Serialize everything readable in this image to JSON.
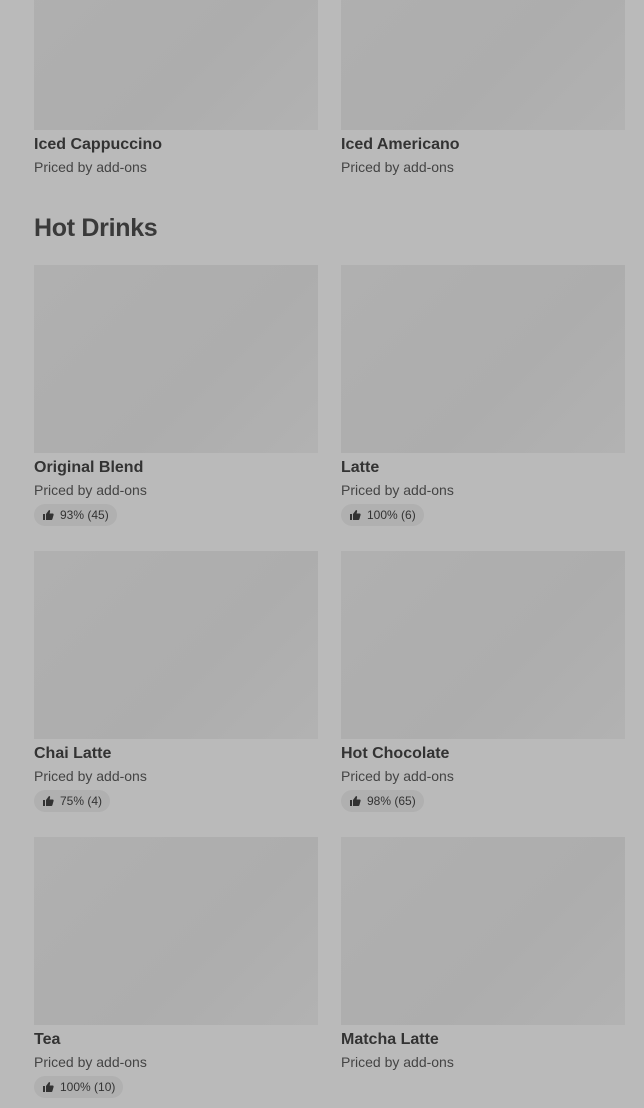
{
  "section": {
    "title": "Hot Drinks"
  },
  "colors": {
    "background": "#bababa",
    "thumbnail": "#afafaf",
    "text": "#333333"
  },
  "cards": [
    {
      "name": "Iced Cappuccino",
      "price": "Priced by add-ons"
    },
    {
      "name": "Iced Americano",
      "price": "Priced by add-ons"
    },
    {
      "name": "Original Blend",
      "price": "Priced by add-ons",
      "rating": "93% (45)",
      "icon": "thumbs-up-icon"
    },
    {
      "name": "Latte",
      "price": "Priced by add-ons",
      "rating": "100% (6)",
      "icon": "thumbs-up-icon"
    },
    {
      "name": "Chai Latte",
      "price": "Priced by add-ons",
      "rating": "75% (4)",
      "icon": "thumbs-up-icon"
    },
    {
      "name": "Hot Chocolate",
      "price": "Priced by add-ons",
      "rating": "98% (65)",
      "icon": "thumbs-up-icon"
    },
    {
      "name": "Tea",
      "price": "Priced by add-ons",
      "rating": "100% (10)",
      "icon": "thumbs-up-icon"
    },
    {
      "name": "Matcha Latte",
      "price": "Priced by add-ons"
    }
  ]
}
